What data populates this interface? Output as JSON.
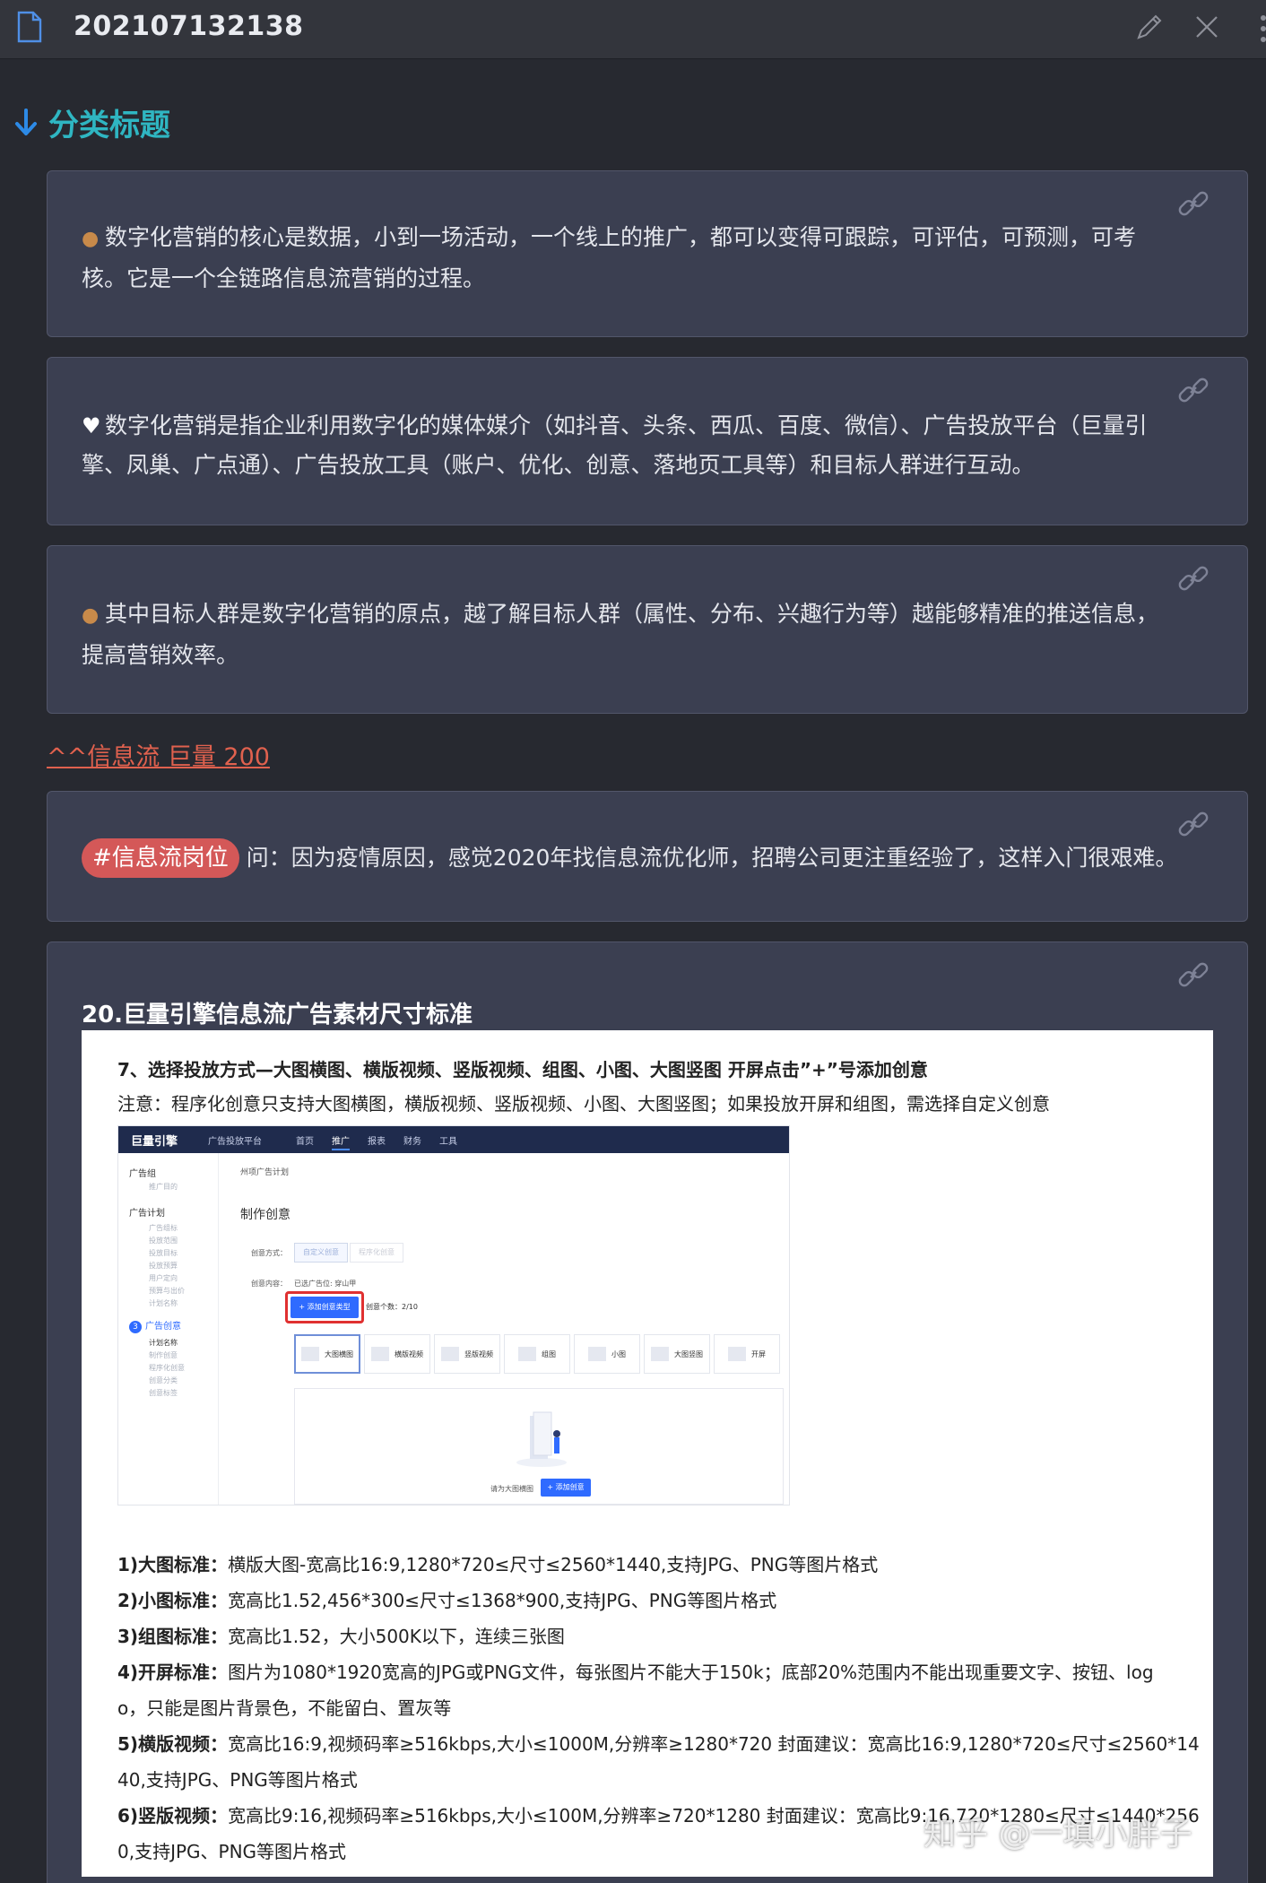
{
  "titlebar": {
    "title": "202107132138",
    "icons": [
      "document-icon",
      "pencil-icon",
      "close-icon",
      "more-icon"
    ]
  },
  "section": {
    "title": "分类标题",
    "icon": "arrow-down-icon",
    "color": "#2fb6c2"
  },
  "cards": [
    {
      "icon": "bear-emoji",
      "lines": [
        "数字化营销的核心是数据，小到一场活动，一个线上的推广，都可以变得可跟踪，可评估，可预测，可考",
        "核。它是一个全链路信息流营销的过程。"
      ]
    },
    {
      "icon": "heart-emoji",
      "lines": [
        "数字化营销是指企业利用数字化的媒体媒介（如抖音、头条、西瓜、百度、微信）、广告投放平台（巨量引",
        "擎、凤巢、广点通）、广告投放工具（账户、优化、创意、落地页工具等）和目标人群进行互动。"
      ]
    },
    {
      "icon": "monkey-emoji",
      "lines": [
        "其中目标人群是数字化营销的原点，越了解目标人群（属性、分布、兴趣行为等）越能够精准的推送信息，",
        "提高营销效率。"
      ]
    }
  ],
  "link": {
    "text": "^^信息流 巨量 200",
    "color": "#e0614e"
  },
  "question_card": {
    "tag": "#信息流岗位",
    "text": "问：因为疫情原因，感觉2020年找信息流优化师，招聘公司更注重经验了，这样入门很艰难。",
    "tag_color": "#d45858"
  },
  "material_card": {
    "heading": "20.巨量引擎信息流广告素材尺寸标准",
    "step": "7、选择投放方式—大图横图、横版视频、竖版视频、组图、小图、大图竖图  开屏点击”+”号添加创意",
    "note": "注意：程序化创意只支持大图横图，横版视频、竖版视频、小图、大图竖图；如果投放开屏和组图，需选择自定义创意",
    "screenshot": {
      "brand": "巨量引擎",
      "subtitle": "广告投放平台",
      "nav": [
        "首页",
        "推广",
        "报表",
        "财务",
        "工具"
      ],
      "sidebar": [
        "广告组",
        "推广目的",
        "广告计划",
        "广告组标",
        "投放范围",
        "投放目标",
        "投放预算",
        "用户定向",
        "预算与出价",
        "计划名称",
        "广告创意",
        "计划名称",
        "制作创意",
        "程序化创意",
        "创意分类",
        "创意标签"
      ],
      "breadcrumb": "州项广告计划",
      "heading": "制作创意",
      "method_label": "创意方式：",
      "method_options": [
        "自定义创意",
        "程序化创意"
      ],
      "content_label": "创意内容：",
      "content_value": "已选广告位: 穿山甲",
      "add_type": "+ 添加创意类型",
      "count": "创意个数：2/10",
      "types": [
        "大图横图",
        "横版视频",
        "竖版视频",
        "组图",
        "小图",
        "大图竖图",
        "开屏"
      ],
      "drop_label": "请为大图横图",
      "drop_button": "+ 添加创意",
      "step_number": "3"
    },
    "specs": [
      {
        "label": "1)大图标准：",
        "lines": [
          "横版大图-宽高比16:9,1280*720≤尺寸≤2560*1440,支持JPG、PNG等图片格式"
        ]
      },
      {
        "label": "2)小图标准：",
        "lines": [
          "宽高比1.52,456*300≤尺寸≤1368*900,支持JPG、PNG等图片格式"
        ]
      },
      {
        "label": "3)组图标准：",
        "lines": [
          "宽高比1.52，大小500K以下，连续三张图"
        ]
      },
      {
        "label": "4)开屏标准：",
        "lines": [
          "图片为1080*1920宽高的JPG或PNG文件，每张图片不能大于150k；底部20%范围内不能出现重要文字、按钮、log",
          "o，只能是图片背景色，不能留白、置灰等"
        ]
      },
      {
        "label": "5)横版视频：",
        "lines": [
          "宽高比16:9,视频码率≥516kbps,大小≤1000M,分辨率≥1280*720 封面建议：宽高比16:9,1280*720≤尺寸≤2560*14",
          "40,支持JPG、PNG等图片格式"
        ]
      },
      {
        "label": "6)竖版视频：",
        "lines": [
          "宽高比9:16,视频码率≥516kbps,大小≤100M,分辨率≥720*1280 封面建议：宽高比9:16,720*1280≤尺寸≤1440*256",
          "0,支持JPG、PNG等图片格式"
        ]
      }
    ]
  },
  "watermark": "知乎 @一填小胖子"
}
